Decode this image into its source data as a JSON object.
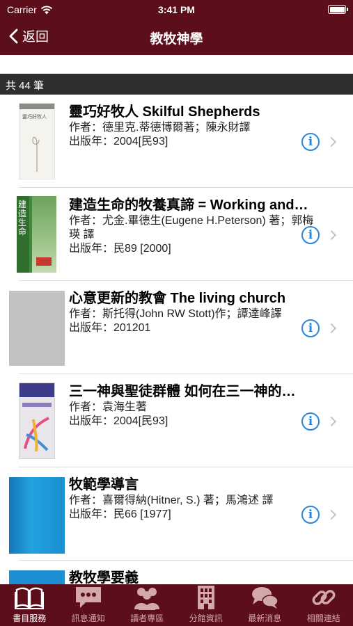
{
  "status_bar": {
    "carrier": "Carrier",
    "time": "3:41 PM"
  },
  "nav": {
    "back_label": "返回",
    "title": "教牧神學"
  },
  "count_label": "共 44 筆",
  "books": [
    {
      "title": "靈巧好牧人 Skilful Shepherds",
      "author": "作者：德里克.蒂德博爾著；陳永財譯",
      "year": "出版年：2004[民93]"
    },
    {
      "title": "建造生命的牧養真諦 = Working and…",
      "author": "作者：尤金.畢德生(Eugene H.Peterson) 著；郭梅瑛 譯",
      "year": "出版年：民89 [2000]"
    },
    {
      "title": "心意更新的教會 The living church",
      "author": "作者：斯托得(John RW Stott)作；譚達峰譯",
      "year": "出版年：201201"
    },
    {
      "title": "三一神與聖徒群體 如何在三一神的…",
      "author": "作者：袁海生著",
      "year": "出版年：2004[民93]"
    },
    {
      "title": "牧範學導言",
      "author": "作者：喜爾得納(Hitner, S.) 著；馬鴻述 譯",
      "year": "出版年：民66 [1977]"
    },
    {
      "title": "教牧學要義",
      "author": "",
      "year": ""
    }
  ],
  "cover_texts": {
    "book1": "靈巧好牧人",
    "book2": "建造生命"
  },
  "tabs": [
    {
      "label": "書目服務",
      "icon": "book-icon",
      "active": true
    },
    {
      "label": "訊息通知",
      "icon": "chat-bubble-icon",
      "active": false
    },
    {
      "label": "讀者專區",
      "icon": "people-icon",
      "active": false
    },
    {
      "label": "分館資訊",
      "icon": "building-icon",
      "active": false
    },
    {
      "label": "最新消息",
      "icon": "speech-bubbles-icon",
      "active": false
    },
    {
      "label": "相關連結",
      "icon": "link-icon",
      "active": false
    }
  ],
  "colors": {
    "brand": "#5c0f1b",
    "info": "#2a85d8"
  }
}
